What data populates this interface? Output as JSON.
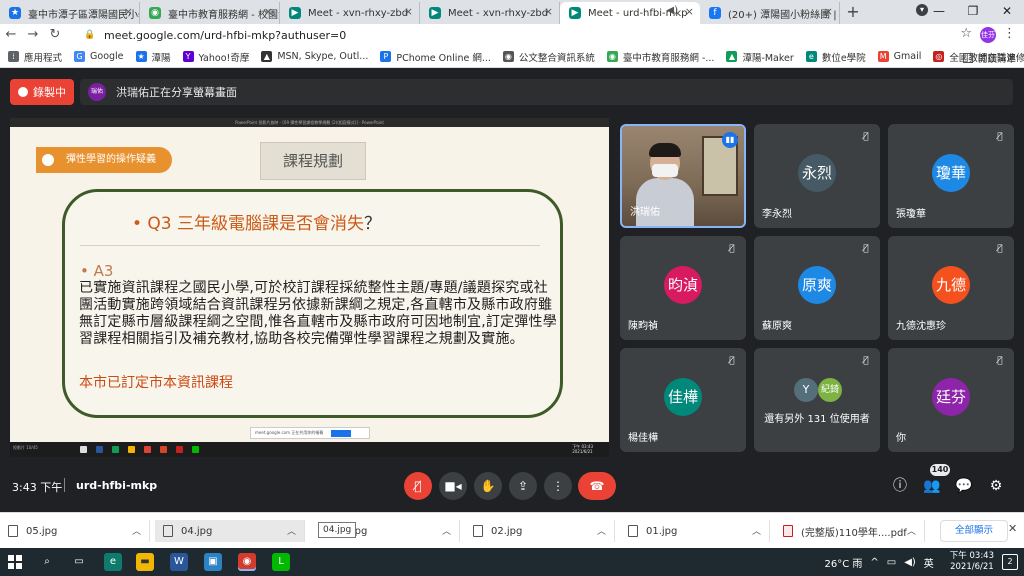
{
  "browser": {
    "tabs": [
      {
        "title": "臺中市潭子區潭陽國民小學",
        "icon_color": "#1a73e8",
        "icon": "school-icon"
      },
      {
        "title": "臺中市教育服務網 - 校園活",
        "icon_color": "#34a853",
        "icon": "globe-icon"
      },
      {
        "title": "Meet - xvn-rhxy-zbd",
        "icon_color": "#00897b",
        "icon": "meet-icon"
      },
      {
        "title": "Meet - xvn-rhxy-zbd",
        "icon_color": "#00897b",
        "icon": "meet-icon"
      },
      {
        "title": "Meet - urd-hfbi-mkp",
        "icon_color": "#00897b",
        "icon": "meet-icon",
        "active": true
      },
      {
        "title": "(20+) 潭陽國小粉絲團 | Fac",
        "icon_color": "#1877f2",
        "icon": "facebook-icon"
      }
    ],
    "new_tab": "+",
    "url": "meet.google.com/urd-hfbi-mkp?authuser=0",
    "profile": "佳芬",
    "bookmarks": [
      {
        "label": "應用程式",
        "color": "#5f6368"
      },
      {
        "label": "Google",
        "color": "#4285f4"
      },
      {
        "label": "潭陽",
        "color": "#1a73e8"
      },
      {
        "label": "Yahoo!奇摩",
        "color": "#6001d2"
      },
      {
        "label": "MSN, Skype, Outl...",
        "color": "#333333"
      },
      {
        "label": "PChome Online 網...",
        "color": "#1a73e8"
      },
      {
        "label": "公文整合資訊系統",
        "color": "#555555"
      },
      {
        "label": "臺中市教育服務網 -...",
        "color": "#34a853"
      },
      {
        "label": "潭陽-Maker",
        "color": "#0f9d58"
      },
      {
        "label": "數位e學院",
        "color": "#00897b"
      },
      {
        "label": "Gmail",
        "color": "#ea4335"
      },
      {
        "label": "全國教師在職進修...",
        "color": "#c5221f"
      }
    ],
    "reading_list": "閱讀清單"
  },
  "meet": {
    "recording_label": "錄製中",
    "presenter_avatar": "瑞佑",
    "presenting_text": "洪瑞佑正在分享螢幕畫面",
    "meeting_time": "3:43 下午",
    "meeting_code": "urd-hfbi-mkp",
    "participant_count": "140"
  },
  "slide": {
    "ppt_title": "PowerPoint 投影片放映 - [09 彈性學習課程教學規劃 (2)(相容模式)] - PowerPoint",
    "tag": "彈性學習的操作疑義",
    "section": "課程規劃",
    "question_prefix": "• Q3  ",
    "question": "三年級電腦課是否會消失",
    "question_mark": "？",
    "answer_label": "• A3",
    "answer_text": "已實施資訊課程之國民小學,可於校訂課程採統整性主題/專題/議題探究或社團活動實施跨領域結合資訊課程另依據新課綱之規定,各直轄市及縣市政府雖無訂定縣市層級課程綱之空間,惟各直轄市及縣市政府可因地制宜,訂定彈性學習課程相關指引及補充教材,協助各校完備彈性學習課程之規劃及實施。",
    "note": "本市已訂定市本資訊課程",
    "share_pill": "meet.google.com 正在共用你的螢幕",
    "status_left": "投影片 10/45",
    "clock": "下午 03:43\n2021/6/21"
  },
  "participants": [
    {
      "name": "洪瑞佑",
      "type": "camera"
    },
    {
      "name": "李永烈",
      "initials": "永烈",
      "color": "#455a64"
    },
    {
      "name": "張瓊華",
      "initials": "瓊華",
      "color": "#1e88e5"
    },
    {
      "name": "陳畇禎",
      "initials": "昀湞",
      "color": "#d81b60"
    },
    {
      "name": "蘇原爽",
      "initials": "原爽",
      "color": "#1e88e5"
    },
    {
      "name": "九德沈惠珍",
      "initials": "九德",
      "color": "#f4511e"
    },
    {
      "name": "楊佳樺",
      "initials": "佳樺",
      "color": "#00897b"
    },
    {
      "name": "",
      "type": "more",
      "more_text": "還有另外 131 位使用者",
      "a1": "Y",
      "a1_color": "#546e7a",
      "a2": "紀錡",
      "a2_color": "#7cb342"
    },
    {
      "name": "你",
      "initials": "廷芬",
      "color": "#8e24aa"
    }
  ],
  "downloads": [
    {
      "name": "05.jpg"
    },
    {
      "name": "04.jpg"
    },
    {
      "name": "03.jpg"
    },
    {
      "name": "02.jpg"
    },
    {
      "name": "01.jpg"
    },
    {
      "name": "(完整版)110學年....pdf",
      "pdf": true
    }
  ],
  "download_tooltip": "04.jpg",
  "show_all": "全部顯示",
  "taskbar": {
    "weather": "26°C  雨",
    "ime": "英",
    "time": "下午 03:43",
    "date": "2021/6/21",
    "notifications": "2"
  }
}
